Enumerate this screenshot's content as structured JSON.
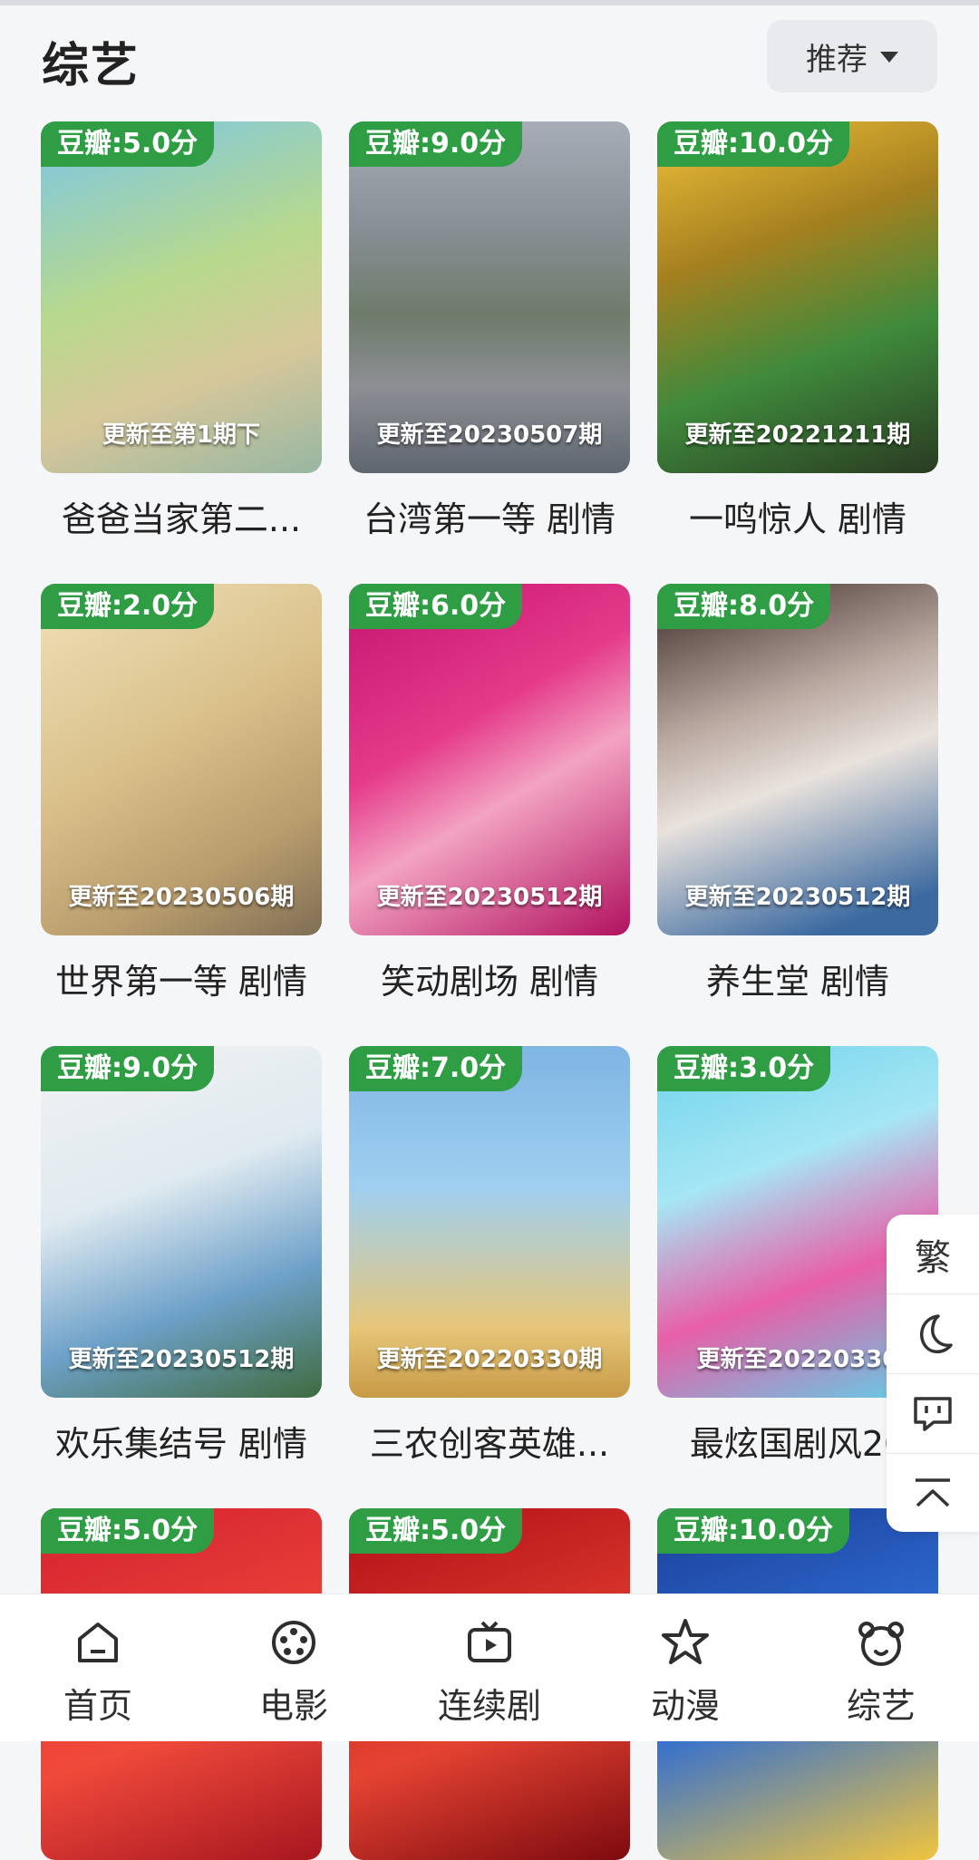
{
  "header": {
    "title": "综艺",
    "sort_label": "推荐"
  },
  "items": [
    {
      "rating": "豆瓣:5.0分",
      "update": "更新至第1期下",
      "name": "爸爸当家第二..."
    },
    {
      "rating": "豆瓣:9.0分",
      "update": "更新至20230507期",
      "name": "台湾第一等 剧情"
    },
    {
      "rating": "豆瓣:10.0分",
      "update": "更新至20221211期",
      "name": "一鸣惊人 剧情"
    },
    {
      "rating": "豆瓣:2.0分",
      "update": "更新至20230506期",
      "name": "世界第一等 剧情"
    },
    {
      "rating": "豆瓣:6.0分",
      "update": "更新至20230512期",
      "name": "笑动剧场 剧情"
    },
    {
      "rating": "豆瓣:8.0分",
      "update": "更新至20230512期",
      "name": "养生堂 剧情"
    },
    {
      "rating": "豆瓣:9.0分",
      "update": "更新至20230512期",
      "name": "欢乐集结号 剧情"
    },
    {
      "rating": "豆瓣:7.0分",
      "update": "更新至20220330期",
      "name": "三农创客英雄..."
    },
    {
      "rating": "豆瓣:3.0分",
      "update": "更新至20220330",
      "name": "最炫国剧风20"
    },
    {
      "rating": "豆瓣:5.0分",
      "update": "",
      "name": ""
    },
    {
      "rating": "豆瓣:5.0分",
      "update": "",
      "name": ""
    },
    {
      "rating": "豆瓣:10.0分",
      "update": "",
      "name": ""
    }
  ],
  "side_tools": {
    "traditional_label": "繁"
  },
  "tabs": [
    {
      "label": "首页",
      "icon": "home-icon"
    },
    {
      "label": "电影",
      "icon": "film-reel-icon"
    },
    {
      "label": "连续剧",
      "icon": "tv-icon"
    },
    {
      "label": "动漫",
      "icon": "star-icon"
    },
    {
      "label": "综艺",
      "icon": "bear-icon"
    }
  ]
}
